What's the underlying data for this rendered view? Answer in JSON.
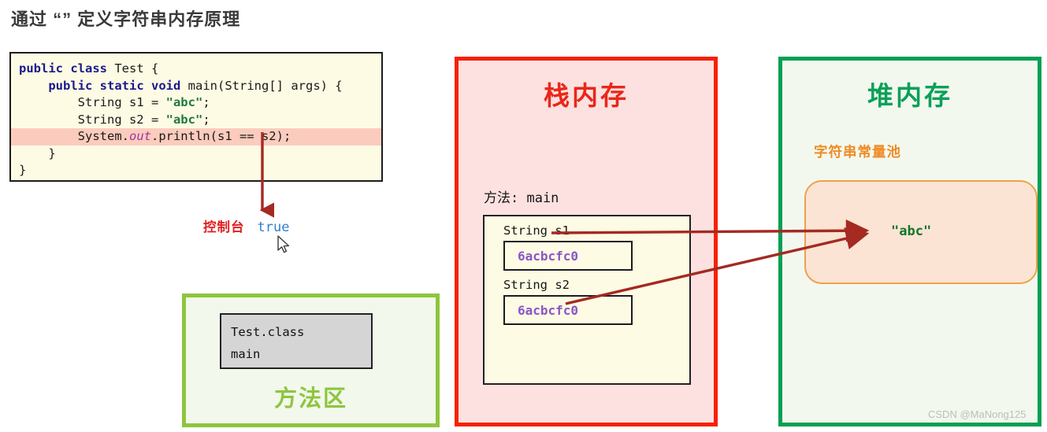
{
  "page": {
    "title": "通过 “” 定义字符串内存原理",
    "watermark": "CSDN @MaNong125"
  },
  "code_block": {
    "language": "java",
    "highlighted_line_index": 4,
    "lines": [
      {
        "indent": 0,
        "tokens": [
          {
            "t": "public",
            "c": "kw"
          },
          {
            "t": " ",
            "c": ""
          },
          {
            "t": "class",
            "c": "kw"
          },
          {
            "t": " Test {",
            "c": ""
          }
        ]
      },
      {
        "indent": 1,
        "tokens": [
          {
            "t": "public",
            "c": "kw"
          },
          {
            "t": " ",
            "c": ""
          },
          {
            "t": "static",
            "c": "kw"
          },
          {
            "t": " ",
            "c": ""
          },
          {
            "t": "void",
            "c": "kw"
          },
          {
            "t": " main(String[] args) {",
            "c": ""
          }
        ]
      },
      {
        "indent": 2,
        "tokens": [
          {
            "t": "String s1 = ",
            "c": ""
          },
          {
            "t": "\"abc\"",
            "c": "str"
          },
          {
            "t": ";",
            "c": ""
          }
        ]
      },
      {
        "indent": 2,
        "tokens": [
          {
            "t": "String s2 = ",
            "c": ""
          },
          {
            "t": "\"abc\"",
            "c": "str"
          },
          {
            "t": ";",
            "c": ""
          }
        ]
      },
      {
        "indent": 2,
        "tokens": [
          {
            "t": "System.",
            "c": ""
          },
          {
            "t": "out",
            "c": "fld"
          },
          {
            "t": ".println(s1 == s2);",
            "c": ""
          }
        ]
      },
      {
        "indent": 1,
        "tokens": [
          {
            "t": "}",
            "c": ""
          }
        ]
      },
      {
        "indent": 0,
        "tokens": [
          {
            "t": "}",
            "c": ""
          }
        ]
      }
    ]
  },
  "console": {
    "label": "控制台",
    "value": "true"
  },
  "method_area": {
    "title": "方法区",
    "box_lines": [
      "Test.class",
      "main"
    ]
  },
  "stack_memory": {
    "title": "栈内存",
    "method_label": "方法: main",
    "variables": [
      {
        "name": "String s1",
        "value": "6acbcfc0"
      },
      {
        "name": "String s2",
        "value": "6acbcfc0"
      }
    ]
  },
  "heap_memory": {
    "title": "堆内存",
    "pool_label": "字符串常量池",
    "pool_value": "\"abc\""
  },
  "colors": {
    "stack_border": "#f72000",
    "stack_title": "#e8271a",
    "heap_border": "#00a053",
    "heap_title": "#0ba059",
    "method_area_border": "#8cc63e",
    "pool_border": "#efa04a",
    "pool_label": "#ef8b24",
    "arrow": "#a42a22",
    "address_text": "#8a56c8",
    "console_value": "#2f7fd0"
  }
}
